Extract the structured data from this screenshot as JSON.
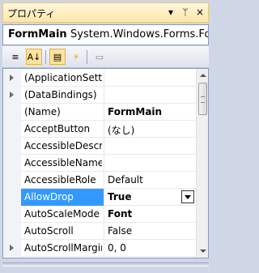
{
  "window": {
    "title": "プロパティ",
    "title_icons": [
      "▾",
      "ᛘ",
      "×"
    ]
  },
  "object_selector": {
    "name": "FormMain",
    "type": "System.Windows.Forms.Fo"
  },
  "toolbar": {
    "buttons": [
      {
        "name": "categorized-button",
        "glyph": "≡"
      },
      {
        "name": "alphabetical-button",
        "glyph": "A↓"
      },
      {
        "name": "properties-button",
        "glyph": "▤"
      },
      {
        "name": "events-button",
        "glyph": "⚡"
      },
      {
        "name": "property-pages-button",
        "glyph": "▭"
      }
    ]
  },
  "properties": [
    {
      "name": "(ApplicationSett",
      "value": "",
      "expandable": true
    },
    {
      "name": "(DataBindings)",
      "value": "",
      "expandable": true
    },
    {
      "name": "(Name)",
      "value": "FormMain",
      "bold": true
    },
    {
      "name": "AcceptButton",
      "value": "(なし)"
    },
    {
      "name": "AccessibleDescr",
      "value": ""
    },
    {
      "name": "AccessibleName",
      "value": ""
    },
    {
      "name": "AccessibleRole",
      "value": "Default"
    },
    {
      "name": "AllowDrop",
      "value": "True",
      "bold": true,
      "selected": true
    },
    {
      "name": "AutoScaleMode",
      "value": "Font",
      "bold": true
    },
    {
      "name": "AutoScroll",
      "value": "False"
    },
    {
      "name": "AutoScrollMargin",
      "value": "0, 0",
      "expandable": true
    }
  ],
  "colors": {
    "title_bg": "#ffe6a8",
    "selection": "#3399ff",
    "frame": "#cfd6e5"
  }
}
